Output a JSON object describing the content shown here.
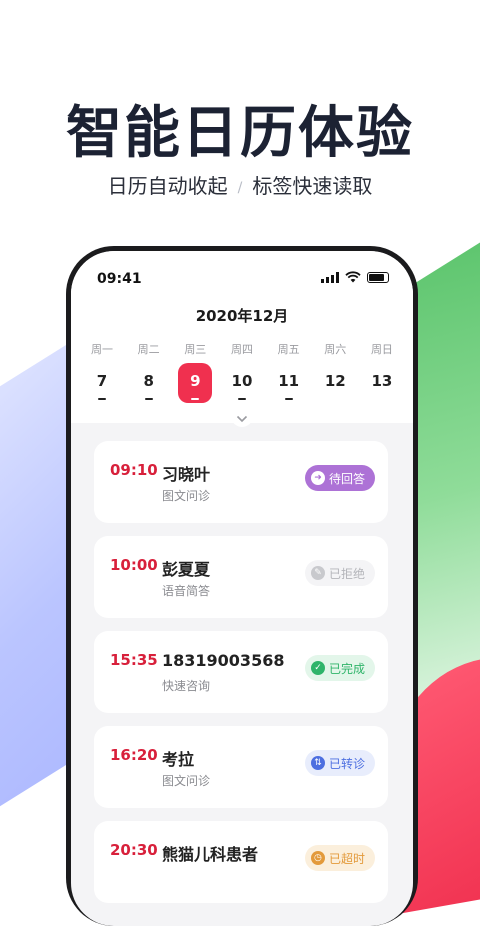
{
  "hero": {
    "title": "智能日历体验",
    "subtitle_left": "日历自动收起",
    "separator": "/",
    "subtitle_right": "标签快速读取"
  },
  "status_bar": {
    "time": "09:41"
  },
  "calendar": {
    "month": "2020年12月",
    "weekdays": [
      "周一",
      "周二",
      "周三",
      "周四",
      "周五",
      "周六",
      "周日"
    ],
    "days": [
      {
        "num": "7",
        "dot": true
      },
      {
        "num": "8",
        "dot": true
      },
      {
        "num": "9",
        "dot": true,
        "selected": true
      },
      {
        "num": "10",
        "dot": true
      },
      {
        "num": "11",
        "dot": true
      },
      {
        "num": "12",
        "dot": false
      },
      {
        "num": "13",
        "dot": false
      }
    ]
  },
  "appointments": [
    {
      "time": "09:10",
      "name": "习晓叶",
      "type": "图文问诊",
      "status": "待回答",
      "status_color": "#a86dd2",
      "status_bg": "#ad72d6",
      "status_text_color": "#ffffff",
      "icon": "arrow-right-icon"
    },
    {
      "time": "10:00",
      "name": "彭夏夏",
      "type": "语音简答",
      "status": "已拒绝",
      "status_color": "#c8c9cd",
      "status_bg": "#f4f4f6",
      "status_text_color": "#b4b5ba",
      "icon": "pencil-icon"
    },
    {
      "time": "15:35",
      "name": "18319003568",
      "type": "快速咨询",
      "status": "已完成",
      "status_color": "#2fb46a",
      "status_bg": "#e3f6ea",
      "status_text_color": "#2fb46a",
      "icon": "check-icon"
    },
    {
      "time": "16:20",
      "name": "考拉",
      "type": "图文问诊",
      "status": "已转诊",
      "status_color": "#4d6fe0",
      "status_bg": "#e8edfc",
      "status_text_color": "#4d6fe0",
      "icon": "transfer-icon"
    },
    {
      "time": "20:30",
      "name": "熊猫儿科患者",
      "type": "",
      "status": "已超时",
      "status_color": "#e39a3b",
      "status_bg": "#fbefdc",
      "status_text_color": "#e39a3b",
      "icon": "clock-icon"
    }
  ]
}
